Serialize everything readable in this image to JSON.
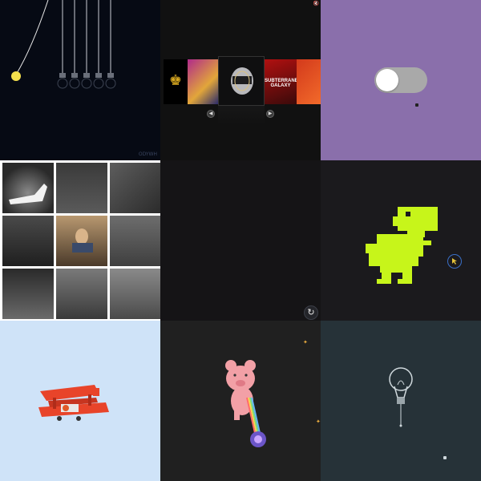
{
  "cells": {
    "pendulum": {
      "credit": "ODYWH"
    },
    "coverflow": {
      "badge": "🔇",
      "prev_icon": "◀",
      "next_icon": "▶",
      "covers": [
        "",
        "",
        "",
        "SUBTERRANEAN GALAXY",
        ""
      ]
    },
    "toggle": {
      "state": "off"
    },
    "dark": {
      "reload_icon": "↻"
    },
    "dino": {},
    "plane": {},
    "pig": {},
    "bulb": {}
  },
  "colors": {
    "pendulum_bg": "#060a14",
    "bulb_yellow": "#f4e04d",
    "toggle_bg": "#8a6fab",
    "dino_green": "#c7f51a",
    "plane_red": "#e8442a",
    "plane_bg": "#cfe3f8",
    "bulb_bg": "#263238",
    "pig_pink": "#f2a0a6"
  }
}
